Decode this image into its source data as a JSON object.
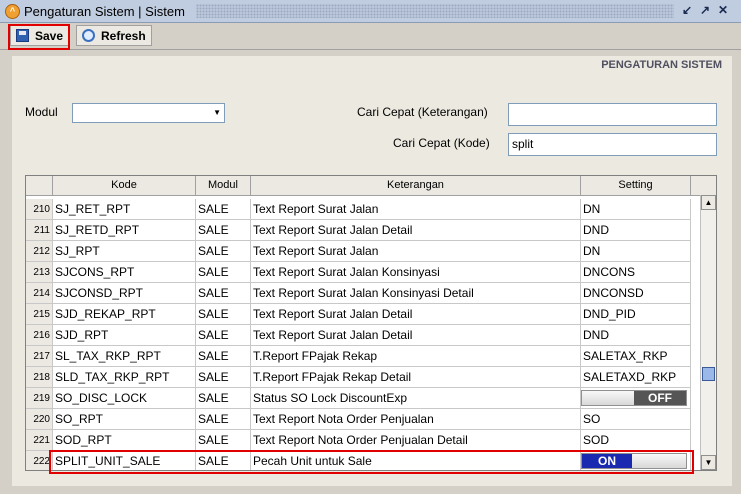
{
  "window": {
    "title": "Pengaturan Sistem | Sistem"
  },
  "toolbar": {
    "save_label": "Save",
    "refresh_label": "Refresh"
  },
  "panel": {
    "title": "PENGATURAN SISTEM"
  },
  "filters": {
    "modul_label": "Modul",
    "modul_value": "",
    "cari_keterangan_label": "Cari Cepat (Keterangan)",
    "cari_keterangan_value": "",
    "cari_kode_label": "Cari Cepat (Kode)",
    "cari_kode_value": "split"
  },
  "grid": {
    "headers": {
      "kode": "Kode",
      "modul": "Modul",
      "keterangan": "Keterangan",
      "setting": "Setting"
    },
    "rows": [
      {
        "no": "210",
        "kode": "SJ_RET_RPT",
        "modul": "SALE",
        "keterangan": "Text Report Surat Jalan",
        "setting": "DN"
      },
      {
        "no": "211",
        "kode": "SJ_RETD_RPT",
        "modul": "SALE",
        "keterangan": "Text Report Surat Jalan Detail",
        "setting": "DND"
      },
      {
        "no": "212",
        "kode": "SJ_RPT",
        "modul": "SALE",
        "keterangan": "Text Report Surat Jalan",
        "setting": "DN"
      },
      {
        "no": "213",
        "kode": "SJCONS_RPT",
        "modul": "SALE",
        "keterangan": "Text Report Surat Jalan Konsinyasi",
        "setting": "DNCONS"
      },
      {
        "no": "214",
        "kode": "SJCONSD_RPT",
        "modul": "SALE",
        "keterangan": "Text Report Surat Jalan Konsinyasi Detail",
        "setting": "DNCONSD"
      },
      {
        "no": "215",
        "kode": "SJD_REKAP_RPT",
        "modul": "SALE",
        "keterangan": "Text Report Surat Jalan Detail",
        "setting": "DND_PID"
      },
      {
        "no": "216",
        "kode": "SJD_RPT",
        "modul": "SALE",
        "keterangan": "Text Report Surat Jalan Detail",
        "setting": "DND"
      },
      {
        "no": "217",
        "kode": "SL_TAX_RKP_RPT",
        "modul": "SALE",
        "keterangan": "T.Report FPajak Rekap",
        "setting": "SALETAX_RKP"
      },
      {
        "no": "218",
        "kode": "SLD_TAX_RKP_RPT",
        "modul": "SALE",
        "keterangan": "T.Report FPajak Rekap Detail",
        "setting": "SALETAXD_RKP"
      },
      {
        "no": "219",
        "kode": "SO_DISC_LOCK",
        "modul": "SALE",
        "keterangan": "Status SO Lock DiscountExp",
        "setting": "OFF",
        "toggle": "off"
      },
      {
        "no": "220",
        "kode": "SO_RPT",
        "modul": "SALE",
        "keterangan": "Text Report Nota Order Penjualan",
        "setting": "SO"
      },
      {
        "no": "221",
        "kode": "SOD_RPT",
        "modul": "SALE",
        "keterangan": "Text Report Nota Order Penjualan Detail",
        "setting": "SOD"
      },
      {
        "no": "222",
        "kode": "SPLIT_UNIT_SALE",
        "modul": "SALE",
        "keterangan": "Pecah Unit untuk Sale",
        "setting": "ON",
        "toggle": "on"
      }
    ]
  },
  "icons": {
    "app": "app-icon",
    "save": "save-icon",
    "refresh": "refresh-icon"
  },
  "colors": {
    "highlight": "#e00000",
    "toggle_on": "#1a2ab0",
    "toggle_off": "#555555"
  }
}
